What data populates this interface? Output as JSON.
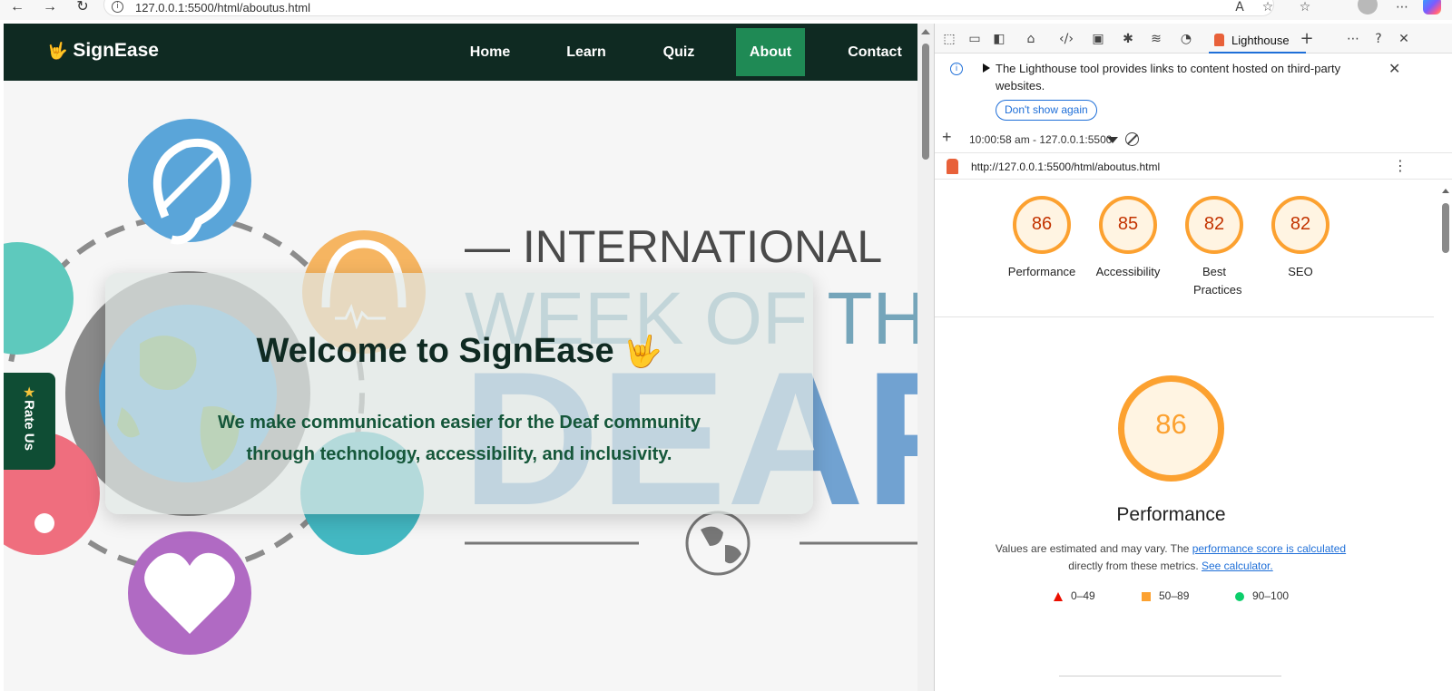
{
  "browser": {
    "url": "127.0.0.1:5500/html/aboutus.html"
  },
  "site": {
    "brand": "SignEase",
    "brand_icon": "🤟",
    "nav": [
      {
        "label": "Home"
      },
      {
        "label": "Learn"
      },
      {
        "label": "Quiz"
      },
      {
        "label": "About",
        "active": true
      },
      {
        "label": "Contact"
      }
    ],
    "hero": {
      "background_text_1": "— INTERNATIONAL",
      "background_text_2": "WEEK OF TH",
      "background_text_3": "DEAF",
      "title": "Welcome to SignEase",
      "title_icon": "🤟",
      "tagline_1": "We make communication easier for the Deaf community",
      "tagline_2": "through technology, accessibility, and inclusivity."
    },
    "rate_us": {
      "icon": "★",
      "label": "Rate Us"
    }
  },
  "devtools": {
    "active_tab": "Lighthouse",
    "banner": {
      "text": "The Lighthouse tool provides links to content hosted on third-party websites.",
      "button": "Don't show again"
    },
    "report_stamp": "10:00:58 am - 127.0.0.1:5500",
    "report_url": "http://127.0.0.1:5500/html/aboutus.html",
    "scores": [
      {
        "value": "86",
        "label": "Performance"
      },
      {
        "value": "85",
        "label": "Accessibility"
      },
      {
        "value": "82",
        "label": "Best Practices"
      },
      {
        "value": "82",
        "label": "SEO"
      }
    ],
    "detail": {
      "value": "86",
      "label": "Performance",
      "note_1": "Values are estimated and may vary. The",
      "note_link_1": "performance score is calculated",
      "note_2": "directly from these metrics.",
      "note_link_2": "See calculator."
    },
    "legend": [
      {
        "range": "0–49",
        "color": "#eb0f00"
      },
      {
        "range": "50–89",
        "color": "#fca130"
      },
      {
        "range": "90–100",
        "color": "#0cce6b"
      }
    ]
  },
  "colors": {
    "site_nav": "#0f2a22",
    "nav_active": "#1f8a55",
    "score_average": "#fca130",
    "link": "#1f6fd8"
  }
}
